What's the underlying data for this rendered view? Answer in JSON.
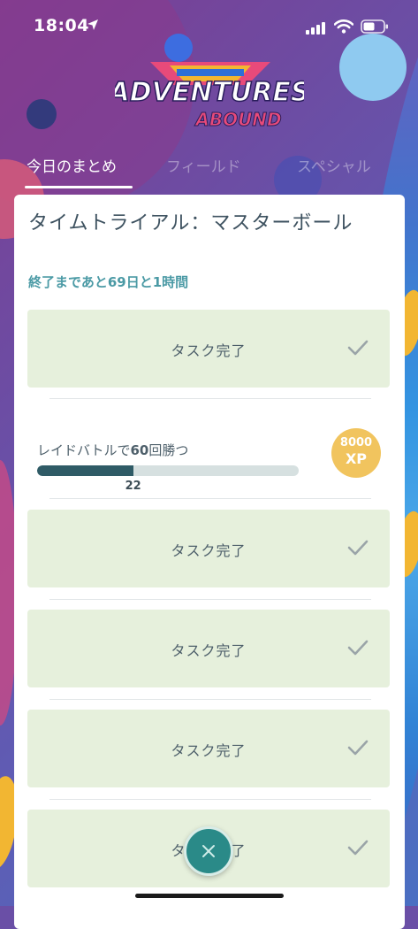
{
  "status_bar": {
    "time": "18:04"
  },
  "logo": {
    "line1": "ADVENTURES",
    "line2": "ABOUND"
  },
  "tabs": [
    {
      "label": "今日のまとめ",
      "active": true
    },
    {
      "label": "フィールド",
      "active": false
    },
    {
      "label": "スペシャル",
      "active": false
    }
  ],
  "research": {
    "title": "タイムトライアル：マスターボール",
    "time_remaining": "終了まであと69日と1時間",
    "completed_label": "タスク完了",
    "active_task": {
      "desc_prefix": "レイドバトルで",
      "desc_count": "60",
      "desc_suffix": "回勝つ",
      "progress_current": "22",
      "progress_fraction": 0.367,
      "reward_amount": "8000",
      "reward_unit": "XP"
    }
  },
  "colors": {
    "accent_teal": "#4b9aa5",
    "task_done_bg": "#e6f0dc",
    "progress_fill": "#2f5b66",
    "reward_badge": "#f1c45e",
    "close_button": "#2a8a88"
  },
  "icons": [
    "location-arrow-icon",
    "signal-icon",
    "wifi-icon",
    "battery-icon",
    "check-icon",
    "close-icon"
  ]
}
